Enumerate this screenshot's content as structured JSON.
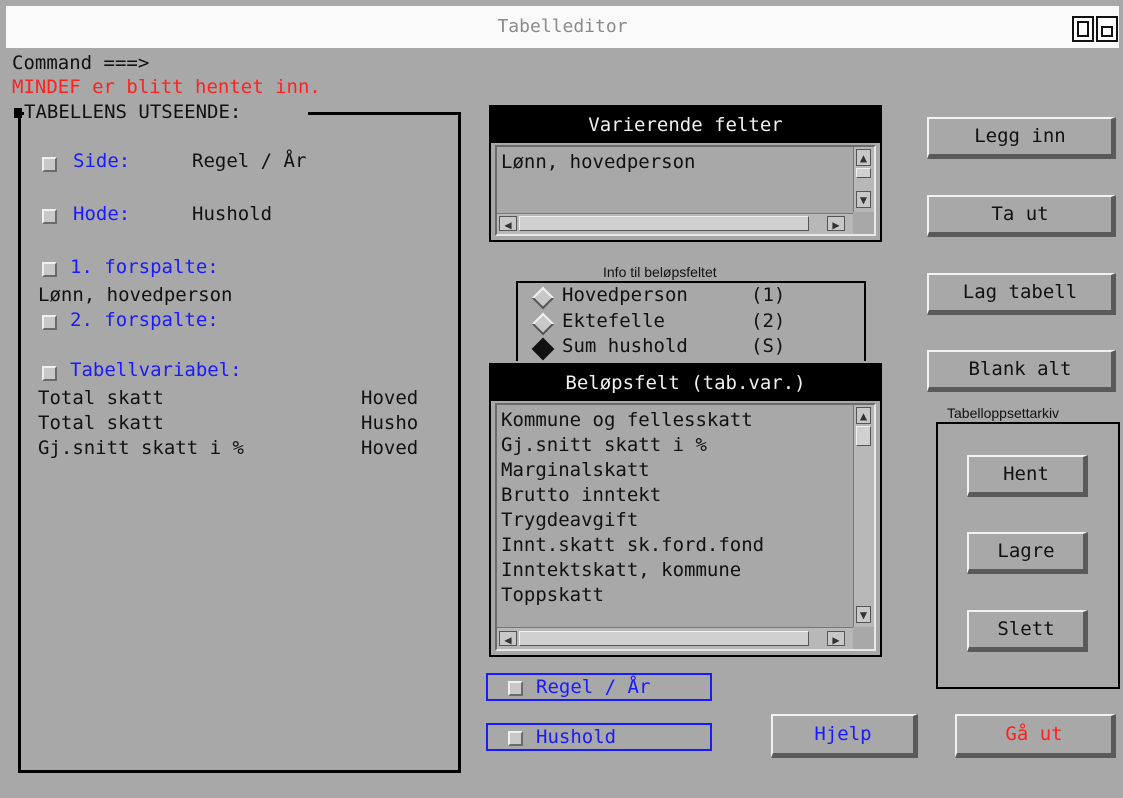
{
  "window": {
    "title": "Tabelleditor"
  },
  "command_line": {
    "prompt": "Command ===>",
    "message": "MINDEF er blitt hentet inn."
  },
  "layout_panel": {
    "title": "TABELLENS UTSEENDE:",
    "side": {
      "label": "Side:",
      "value": "Regel / År"
    },
    "hode": {
      "label": "Hode:",
      "value": "Hushold"
    },
    "forspalte1": {
      "label": "1. forspalte:",
      "value": "Lønn, hovedperson"
    },
    "forspalte2": {
      "label": "2. forspalte:"
    },
    "tabellvariabel": {
      "label": "Tabellvariabel:",
      "rows": [
        {
          "name": "Total skatt",
          "who": "Hoved"
        },
        {
          "name": "Total skatt",
          "who": "Husho"
        },
        {
          "name": "Gj.snitt skatt i %",
          "who": "Hoved"
        }
      ]
    }
  },
  "varierende": {
    "title": "Varierende felter",
    "items": [
      "Lønn, hovedperson"
    ]
  },
  "info": {
    "title": "Info til beløpsfeltet",
    "options": [
      {
        "label": "Hovedperson",
        "code": "(1)",
        "selected": false
      },
      {
        "label": "Ektefelle",
        "code": "(2)",
        "selected": false
      },
      {
        "label": "Sum hushold",
        "code": "(S)",
        "selected": true
      }
    ]
  },
  "belopsfelt": {
    "title": "Beløpsfelt (tab.var.)",
    "items": [
      "Kommune og fellesskatt",
      "Gj.snitt skatt i %",
      "Marginalskatt",
      "Brutto inntekt",
      "Trygdeavgift",
      "Innt.skatt sk.ford.fond",
      "Inntektskatt, kommune",
      "Toppskatt"
    ]
  },
  "bottom_toggles": {
    "regel": "Regel / År",
    "hushold": "Hushold"
  },
  "buttons": {
    "legg_inn": "Legg inn",
    "ta_ut": "Ta ut",
    "lag_tabell": "Lag tabell",
    "blank_alt": "Blank alt",
    "hjelp": "Hjelp",
    "ga_ut": "Gå ut"
  },
  "arkiv": {
    "title": "Tabelloppsettarkiv",
    "hent": "Hent",
    "lagre": "Lagre",
    "slett": "Slett"
  },
  "colors": {
    "background": "#a8a8a8",
    "label_blue": "#1a1aff",
    "message_red": "#ff2020"
  }
}
